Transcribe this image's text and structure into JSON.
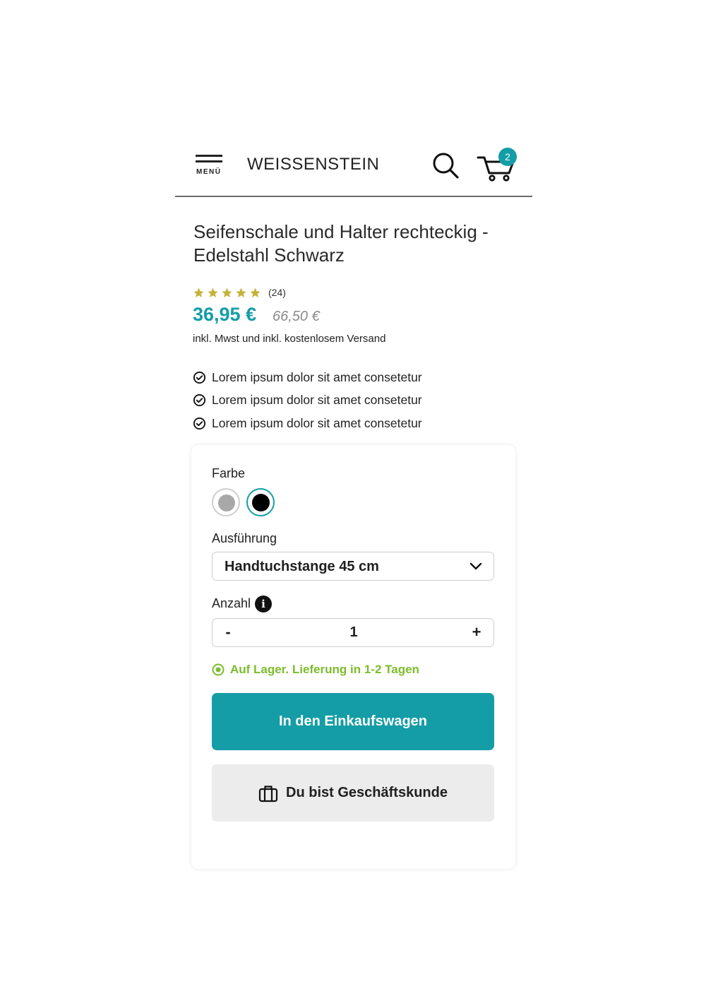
{
  "header": {
    "menu_label": "MENÜ",
    "brand": "WEISSENSTEIN",
    "cart_count": "2",
    "icons": [
      "menu-icon",
      "search-icon",
      "cart-icon"
    ]
  },
  "product": {
    "title": "Seifenschale und Halter rechteckig - Edelstahl Schwarz",
    "rating_stars": 5,
    "rating_count": "(24)",
    "price": "36,95 €",
    "old_price": "66,50 €",
    "tax_note": "inkl. Mwst und inkl. kostenlosem Versand",
    "features": [
      "Lorem ipsum dolor sit amet consetetur",
      "Lorem ipsum dolor sit amet consetetur",
      "Lorem ipsum dolor sit amet consetetur"
    ]
  },
  "options": {
    "color_label": "Farbe",
    "colors": [
      {
        "name": "silver",
        "hex": "#a8a8a8",
        "selected": false
      },
      {
        "name": "black",
        "hex": "#000000",
        "selected": true
      }
    ],
    "variant_label": "Ausführung",
    "variant_value": "Handtuchstange 45 cm",
    "quantity_label": "Anzahl",
    "quantity_minus": "-",
    "quantity_value": "1",
    "quantity_plus": "+",
    "stock_text": "Auf Lager. Lieferung in 1-2 Tagen"
  },
  "actions": {
    "add_to_cart": "In den Einkaufswagen",
    "business_customer": "Du bist Geschäftskunde"
  },
  "colors": {
    "accent": "#149da6",
    "star": "#c6b23a",
    "in_stock": "#7cbc2b",
    "secondary_button": "#ececec"
  }
}
